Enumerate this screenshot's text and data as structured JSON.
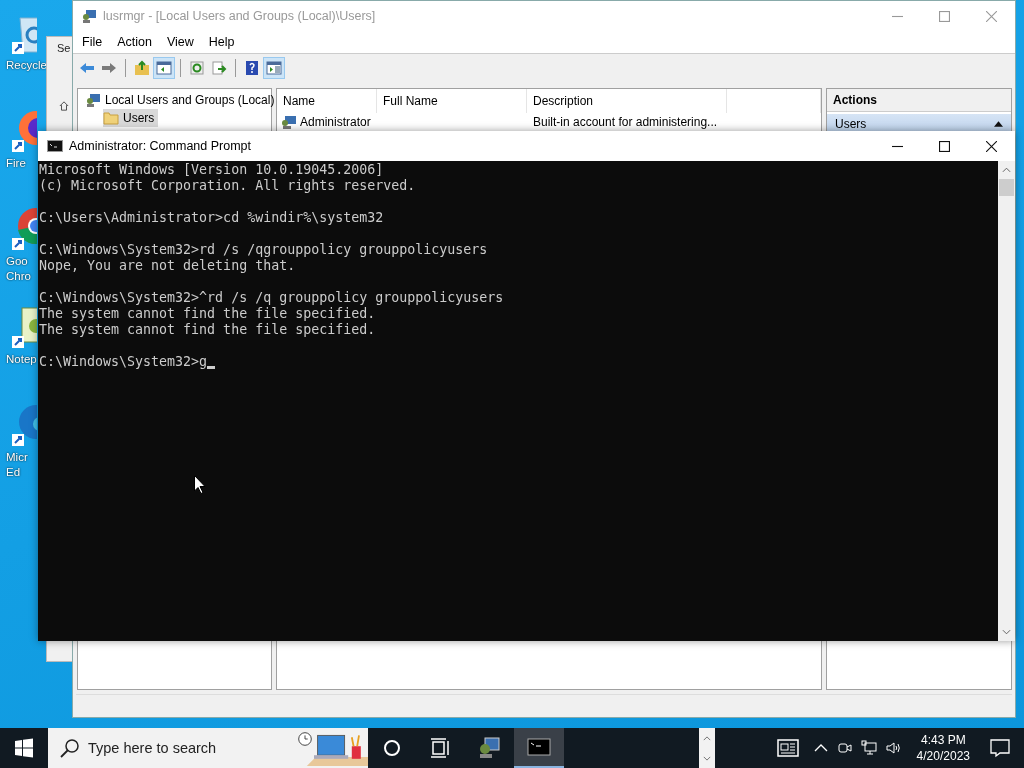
{
  "desktop_icons": [
    {
      "kind": "recycle",
      "lines": [
        "Recycle"
      ]
    },
    {
      "kind": "firefox",
      "lines": [
        "Fire"
      ]
    },
    {
      "kind": "chrome",
      "lines": [
        "Goo",
        "Chro"
      ]
    },
    {
      "kind": "notepad",
      "lines": [
        "Notep"
      ]
    },
    {
      "kind": "edge",
      "lines": [
        "Micr",
        "Ed"
      ]
    }
  ],
  "background_window": {
    "title": "Se"
  },
  "mmc_window": {
    "title": "lusrmgr - [Local Users and Groups (Local)\\Users]",
    "active": false,
    "menu": [
      "File",
      "Action",
      "View",
      "Help"
    ],
    "toolbar": [
      {
        "kind": "back",
        "on": false
      },
      {
        "kind": "forward",
        "on": false
      },
      {
        "kind": "separator"
      },
      {
        "kind": "up",
        "on": false
      },
      {
        "kind": "tree",
        "on": true
      },
      {
        "kind": "separator"
      },
      {
        "kind": "refresh",
        "on": false
      },
      {
        "kind": "export",
        "on": false
      },
      {
        "kind": "separator"
      },
      {
        "kind": "help",
        "on": false
      },
      {
        "kind": "actionpane",
        "on": true
      }
    ],
    "tree": {
      "root": "Local Users and Groups (Local)",
      "children": [
        {
          "label": "Users",
          "selected": true
        }
      ]
    },
    "list": {
      "columns": [
        "Name",
        "Full Name",
        "Description"
      ],
      "rows": [
        {
          "name": "Administrator",
          "description": "Built-in account for administering..."
        }
      ]
    },
    "actions": {
      "title": "Actions",
      "sections": [
        {
          "label": "Users",
          "expanded": true
        }
      ]
    }
  },
  "cmd_window": {
    "title": "Administrator: Command Prompt",
    "blocks": [
      [
        "Microsoft Windows [Version 10.0.19045.2006]",
        "(c) Microsoft Corporation. All rights reserved."
      ],
      [
        "C:\\Users\\Administrator>cd %windir%\\system32"
      ],
      [
        "C:\\Windows\\System32>rd /s /qgrouppolicy grouppolicyusers",
        "Nope, You are not deleting that."
      ],
      [
        "C:\\Windows\\System32>^rd /s /q grouppolicy grouppolicyusers",
        "The system cannot find the file specified.",
        "The system cannot find the file specified."
      ],
      [
        "C:\\Windows\\System32>g"
      ]
    ]
  },
  "taskbar": {
    "search": {
      "placeholder": "Type here to search"
    },
    "apps": [
      {
        "kind": "mmc",
        "active": false
      },
      {
        "kind": "cmd",
        "active": true
      }
    ],
    "clock": {
      "time": "4:43 PM",
      "date": "4/20/2023"
    }
  }
}
